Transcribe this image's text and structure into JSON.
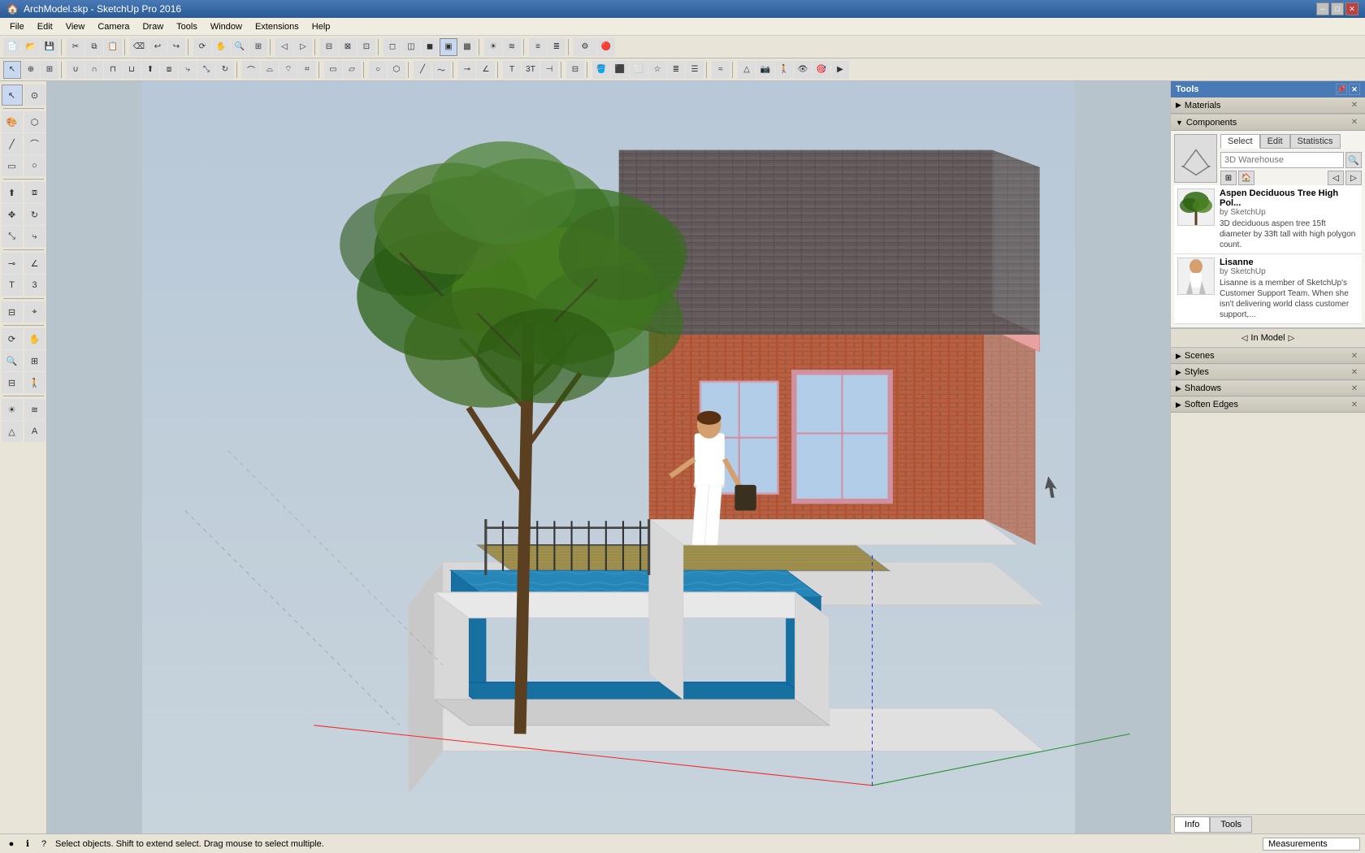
{
  "titlebar": {
    "title": "ArchModel.skp - SketchUp Pro 2016",
    "controls": [
      "minimize",
      "maximize",
      "close"
    ]
  },
  "menubar": {
    "items": [
      "File",
      "Edit",
      "View",
      "Camera",
      "Draw",
      "Tools",
      "Window",
      "Extensions",
      "Help"
    ]
  },
  "toolbar1": {
    "buttons": [
      "new",
      "open",
      "save",
      "print",
      "cut",
      "copy",
      "paste",
      "erase",
      "undo",
      "redo",
      "camera-orbit",
      "camera-pan",
      "camera-zoom",
      "camera-zoom-extents",
      "camera-prev",
      "camera-next",
      "section-plane",
      "section-cut",
      "display-section-planes",
      "toggle-section",
      "wireframe",
      "hidden-line",
      "shaded",
      "shaded-textured",
      "monochrome",
      "xray",
      "shadow",
      "fog",
      "edge-style",
      "profile",
      "depth-cue",
      "extensions-icon"
    ]
  },
  "toolbar2": {
    "buttons": [
      "select",
      "component-explode",
      "group",
      "solid-tools",
      "intersect",
      "push-pull",
      "offset",
      "follow-me",
      "scale",
      "rotate",
      "arc",
      "rectangle",
      "circle",
      "polygon",
      "line",
      "freehand",
      "tape",
      "protractor",
      "text",
      "3d-text",
      "dimension",
      "section",
      "paint",
      "materials",
      "components",
      "styles",
      "layers",
      "outliner",
      "soften",
      "sandbox",
      "advanced-cam",
      "walk",
      "look-around",
      "position-cam",
      "preview"
    ]
  },
  "left_toolbar": {
    "sections": [
      {
        "buttons": [
          "select",
          "component-select"
        ]
      },
      {
        "buttons": [
          "paint",
          "eraser"
        ]
      },
      {
        "buttons": [
          "line",
          "arc"
        ]
      },
      {
        "buttons": [
          "rectangle",
          "circle"
        ]
      },
      {
        "buttons": [
          "push-pull",
          "offset"
        ]
      },
      {
        "buttons": [
          "move",
          "rotate"
        ]
      },
      {
        "buttons": [
          "scale",
          "follow-me"
        ]
      },
      {
        "buttons": [
          "tape",
          "protractor"
        ]
      },
      {
        "buttons": [
          "text",
          "3d-text"
        ]
      },
      {
        "buttons": [
          "section",
          "axes"
        ]
      },
      {
        "buttons": [
          "orbit",
          "pan"
        ]
      },
      {
        "buttons": [
          "zoom",
          "zoom-window"
        ]
      },
      {
        "buttons": [
          "zoom-extents",
          "walk"
        ]
      },
      {
        "buttons": [
          "look-around",
          "position-cam"
        ]
      },
      {
        "buttons": [
          "shadow",
          "fog"
        ]
      },
      {
        "buttons": [
          "unknown1",
          "unknown2"
        ]
      }
    ]
  },
  "right_panel": {
    "tools_label": "Tools",
    "materials_label": "Materials",
    "components_label": "Components",
    "comp_preview_icon": "▢",
    "tabs": [
      {
        "label": "Select",
        "active": true
      },
      {
        "label": "Edit",
        "active": false
      },
      {
        "label": "Statistics",
        "active": false
      }
    ],
    "search_placeholder": "3D Warehouse",
    "nav_icons": [
      "grid-view",
      "home",
      "back",
      "forward"
    ],
    "items": [
      {
        "name": "Aspen Deciduous Tree High Pol...",
        "author": "by SketchUp",
        "description": "3D deciduous aspen tree 15ft diameter by 33ft tall with high polygon count."
      },
      {
        "name": "Lisanne",
        "author": "by SketchUp",
        "description": "Lisanne is a member of SketchUp's Customer Support Team. When she isn't delivering world class customer support,..."
      }
    ],
    "in_model_label": "In Model",
    "lower_sections": [
      {
        "label": "Scenes",
        "expanded": true
      },
      {
        "label": "Styles",
        "expanded": true
      },
      {
        "label": "Shadows",
        "expanded": true
      },
      {
        "label": "Soften Edges",
        "expanded": true
      }
    ]
  },
  "bottom_tabs": [
    {
      "label": "Info",
      "active": true
    },
    {
      "label": "Tools",
      "active": false
    }
  ],
  "statusbar": {
    "icons": [
      "circle-q",
      "circle-i",
      "circle-o"
    ],
    "text": "Select objects. Shift to extend select. Drag mouse to select multiple.",
    "measurements_label": "Measurements",
    "measurements_value": ""
  },
  "viewport": {
    "background_color": "#b8c4cc",
    "scene_description": "3D architectural model with house, tree, and pool"
  }
}
